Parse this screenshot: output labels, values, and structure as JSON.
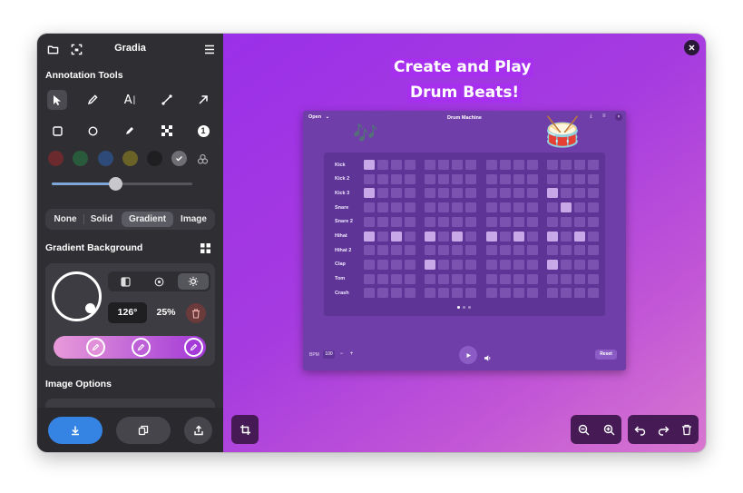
{
  "app": {
    "title": "Gradia"
  },
  "sidebar": {
    "annotation_title": "Annotation Tools",
    "tools": [
      "pointer-icon",
      "pen-icon",
      "text-icon",
      "line-icon",
      "arrow-icon",
      "square-icon",
      "circle-icon",
      "highlighter-icon",
      "censor-icon",
      "number-icon"
    ],
    "swatches": [
      "#6b2a2e",
      "#2a5a3c",
      "#2e4a78",
      "#6b6228",
      "#1f1f22"
    ],
    "bg_modes": [
      "None",
      "Solid",
      "Gradient",
      "Image"
    ],
    "bg_active": "Gradient",
    "gradient_title": "Gradient Background",
    "gradient": {
      "angle": "126°",
      "position": "25%"
    },
    "image_options_title": "Image Options"
  },
  "canvas": {
    "headline_1": "Create and Play",
    "headline_2": "Drum Beats!"
  },
  "drum": {
    "open_label": "Open",
    "title": "Drum Machine",
    "notes_emoji": "🎶",
    "drum_emoji": "🥁",
    "rows": [
      {
        "label": "Kick",
        "on": [
          0
        ]
      },
      {
        "label": "Kick 2",
        "on": []
      },
      {
        "label": "Kick 3",
        "on": [
          0,
          12
        ]
      },
      {
        "label": "Snare",
        "on": [
          13
        ]
      },
      {
        "label": "Snare 2",
        "on": []
      },
      {
        "label": "Hihat",
        "on": [
          0,
          2,
          4,
          6,
          8,
          10,
          12,
          14
        ]
      },
      {
        "label": "Hihat 2",
        "on": []
      },
      {
        "label": "Clap",
        "on": [
          4,
          12
        ]
      },
      {
        "label": "Tom",
        "on": []
      },
      {
        "label": "Crash",
        "on": []
      }
    ],
    "bpm_label": "BPM",
    "bpm_value": "100",
    "minus": "−",
    "plus": "+",
    "reset_label": "Reset"
  }
}
